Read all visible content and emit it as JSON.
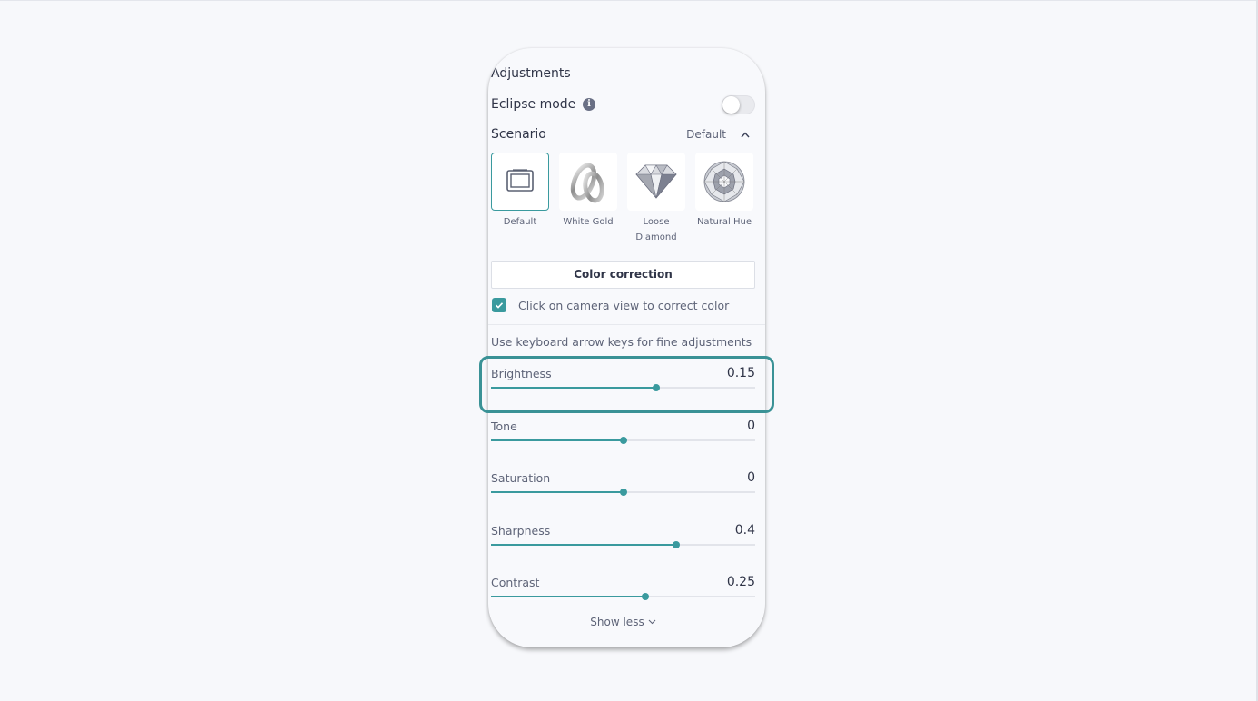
{
  "panel": {
    "title": "Adjustments",
    "eclipse_mode": {
      "label": "Eclipse mode",
      "info_icon": "info-icon",
      "enabled": false
    },
    "scenario": {
      "label": "Scenario",
      "selected_value": "Default",
      "chevron_icon": "chevron-up-icon",
      "items": [
        {
          "label": "Default",
          "icon": "frame-icon",
          "selected": true
        },
        {
          "label": "White Gold",
          "icon": "rings-icon",
          "selected": false
        },
        {
          "label": "Loose Diamond",
          "icon": "diamond-icon",
          "selected": false
        },
        {
          "label": "Natural Hue",
          "icon": "round-diamond-icon",
          "selected": false
        }
      ]
    },
    "color_correction": {
      "button_label": "Color correction",
      "checkbox_label": "Click on camera view to correct color",
      "checked": true
    },
    "hint": "Use keyboard arrow keys for fine adjustments",
    "sliders": [
      {
        "label": "Brightness",
        "value": "0.15",
        "position": 0.625,
        "highlighted": true
      },
      {
        "label": "Tone",
        "value": "0",
        "position": 0.5
      },
      {
        "label": "Saturation",
        "value": "0",
        "position": 0.5
      },
      {
        "label": "Sharpness",
        "value": "0.4",
        "position": 0.7
      },
      {
        "label": "Contrast",
        "value": "0.25",
        "position": 0.585
      }
    ],
    "show_less": "Show less"
  },
  "colors": {
    "accent": "#3a9a9e",
    "highlight_border": "#3a9296"
  }
}
